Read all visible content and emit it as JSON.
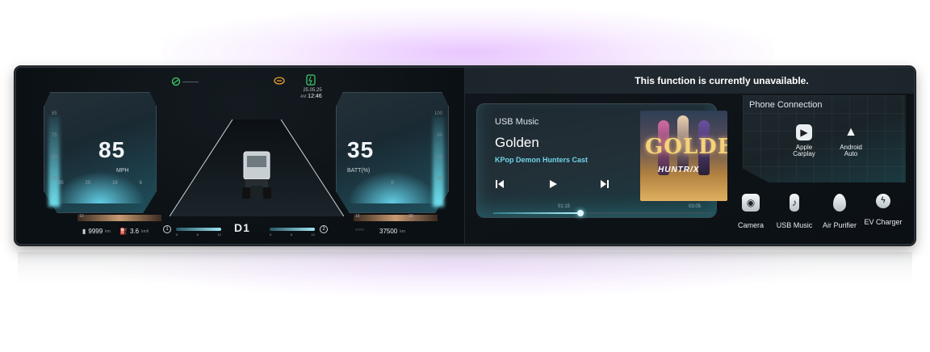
{
  "banner": {
    "message": "This function is currently unavailable."
  },
  "cluster": {
    "speed": {
      "value": "85",
      "unit": "MPH",
      "ticks": [
        "85",
        "75",
        "60",
        "45",
        "30",
        "15"
      ],
      "scale": [
        "35",
        "25",
        "18",
        "6"
      ]
    },
    "battery": {
      "value": "35",
      "unit": "BATT(%)",
      "ticks": [
        "100",
        "80",
        "60",
        "40",
        "20"
      ],
      "scale": [
        "0"
      ]
    },
    "bar_left": {
      "min": "10",
      "max": ""
    },
    "bar_right": {
      "min": "16",
      "max": "32"
    },
    "date": "25.05.25",
    "ampm": "AM",
    "clock": "12:46",
    "odometer_left": {
      "value": "9999",
      "unit": "km"
    },
    "efficiency": {
      "value": "3.6",
      "unit": "km/l"
    },
    "odometer_right": {
      "value": "37500",
      "unit": "km"
    },
    "gear": "D1",
    "gauge_small_left": {
      "label": "1",
      "ticks": [
        "0",
        "6",
        "12"
      ]
    },
    "gauge_small_right": {
      "label": "2",
      "ticks": [
        "0",
        "6",
        "12"
      ]
    }
  },
  "music": {
    "source": "USB Music",
    "title": "Golden",
    "artist": "KPop Demon Hunters Cast",
    "album_word": "GOLDEN",
    "album_logo": "HUNTR/X",
    "elapsed": "01:15",
    "duration": "03:05",
    "progress": 0.4,
    "controls": {
      "prev": "previous-icon",
      "play": "play-icon",
      "next": "next-icon"
    }
  },
  "phone": {
    "title": "Phone Connection",
    "apps": [
      {
        "label1": "Apple",
        "label2": "Carplay",
        "icon": "carplay-icon"
      },
      {
        "label1": "Android",
        "label2": "Auto",
        "icon": "android-auto-icon"
      }
    ]
  },
  "shortcuts": [
    {
      "label": "Camera",
      "icon": "camera-icon"
    },
    {
      "label": "USB Music",
      "icon": "usb-icon"
    },
    {
      "label": "Air Purifier",
      "icon": "droplet-icon"
    },
    {
      "label": "EV Charger",
      "icon": "ev-charger-icon"
    }
  ],
  "colors": {
    "accent": "#6fd6e8",
    "screen_bg": "#0b1014",
    "glow": "#d696ff"
  }
}
